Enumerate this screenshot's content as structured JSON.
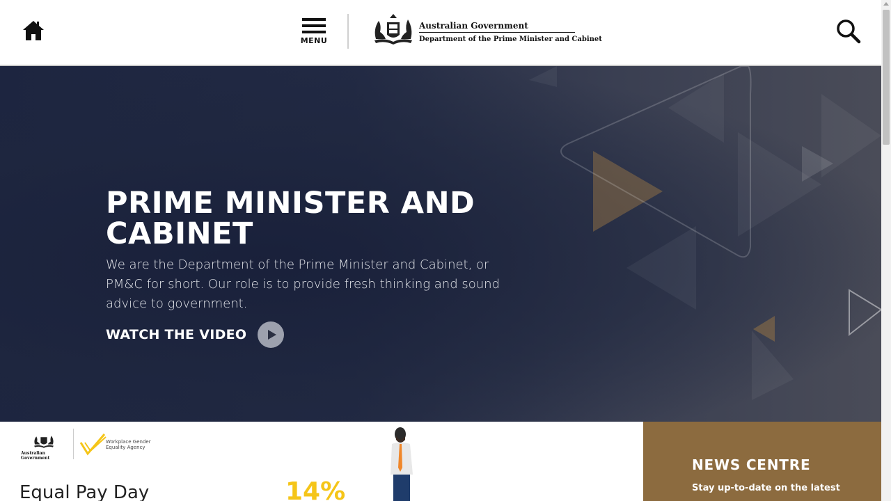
{
  "header": {
    "home_icon": "home-icon",
    "menu_label": "MENU",
    "gov_title": "Australian Government",
    "gov_dept": "Department of the Prime Minister and Cabinet",
    "search_icon": "search-icon"
  },
  "hero": {
    "title": "PRIME MINISTER AND CABINET",
    "description": "We are the Department of the Prime Minister and Cabinet, or PM&C for short. Our role is to provide fresh thinking and sound advice to government.",
    "watch_label": "WATCH THE VIDEO",
    "play_icon": "play-icon"
  },
  "feature": {
    "crest_text": "Australian Government",
    "wgea_text": "Workplace Gender Equality Agency",
    "title": "Equal Pay Day",
    "stat": "14%"
  },
  "news": {
    "title": "NEWS CENTRE",
    "subtitle": "Stay up-to-date on the latest"
  },
  "colors": {
    "hero_bg": "#1d2540",
    "news_bg": "#8c6b3f",
    "accent_gold": "#f5c518"
  }
}
